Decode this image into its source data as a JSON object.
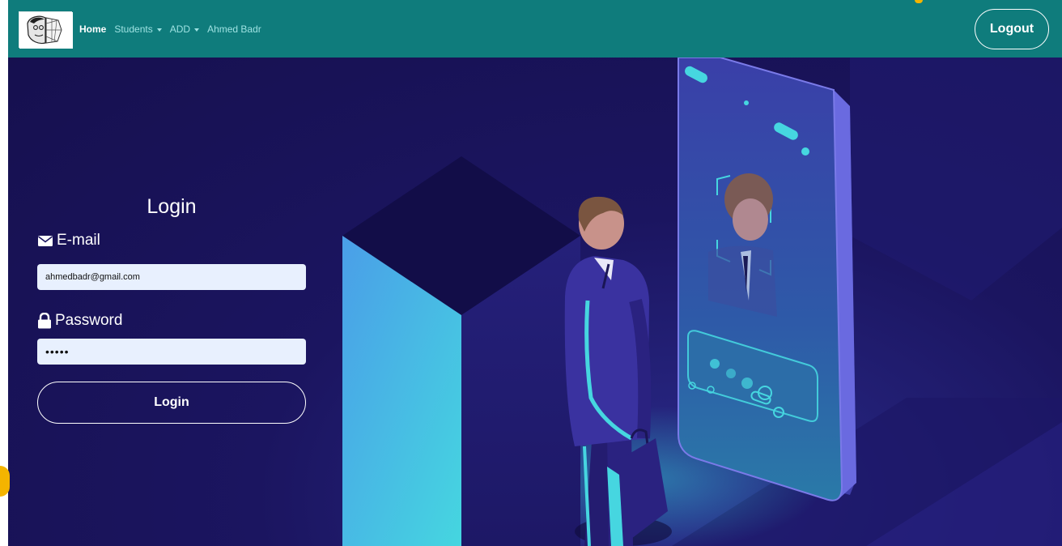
{
  "navbar": {
    "brand_icon": "face-scan-logo",
    "links": [
      {
        "label": "Home",
        "active": true,
        "dropdown": false
      },
      {
        "label": "Students",
        "active": false,
        "dropdown": true
      },
      {
        "label": "ADD",
        "active": false,
        "dropdown": true
      },
      {
        "label": "Ahmed Badr",
        "active": false,
        "dropdown": false
      }
    ],
    "logout_label": "Logout",
    "color": "#0f7c7c"
  },
  "login": {
    "title": "Login",
    "email_label": "E-mail",
    "email_icon": "envelope-icon",
    "email_value": "ahmedbadr@gmail.com",
    "password_label": "Password",
    "password_icon": "lock-icon",
    "password_value": "•••••",
    "submit_label": "Login"
  },
  "theme": {
    "hero_background": "#1b1560",
    "input_background": "#e8f0fe"
  }
}
